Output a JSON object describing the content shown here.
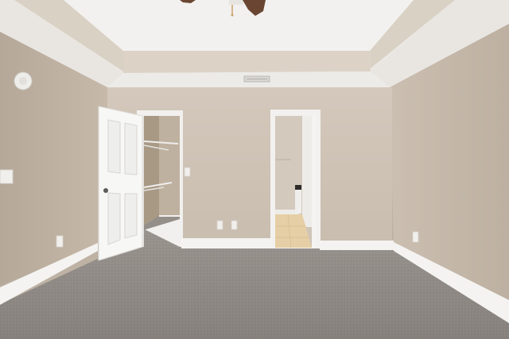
{
  "scene": {
    "kind": "photo-empty-bedroom",
    "palette": {
      "wall": "#c9bdaf",
      "wall_shadow": "#b7aa9b",
      "ceiling": "#f2f1ef",
      "tray_ceiling": "#e5e2dd",
      "trim": "#f4f3f1",
      "carpet": "#8f8a86",
      "closet_interior": "#b7a895",
      "bath_floor": "#e6cfa6",
      "fan_blade": "#6a4632"
    },
    "objects": [
      "ceiling-fan",
      "tray-ceiling",
      "air-vent",
      "smoke-detector",
      "light-switch",
      "open-closet-door",
      "walk-in-closet",
      "bathroom-doorway",
      "carpet-floor",
      "baseboards",
      "electrical-outlets"
    ]
  }
}
